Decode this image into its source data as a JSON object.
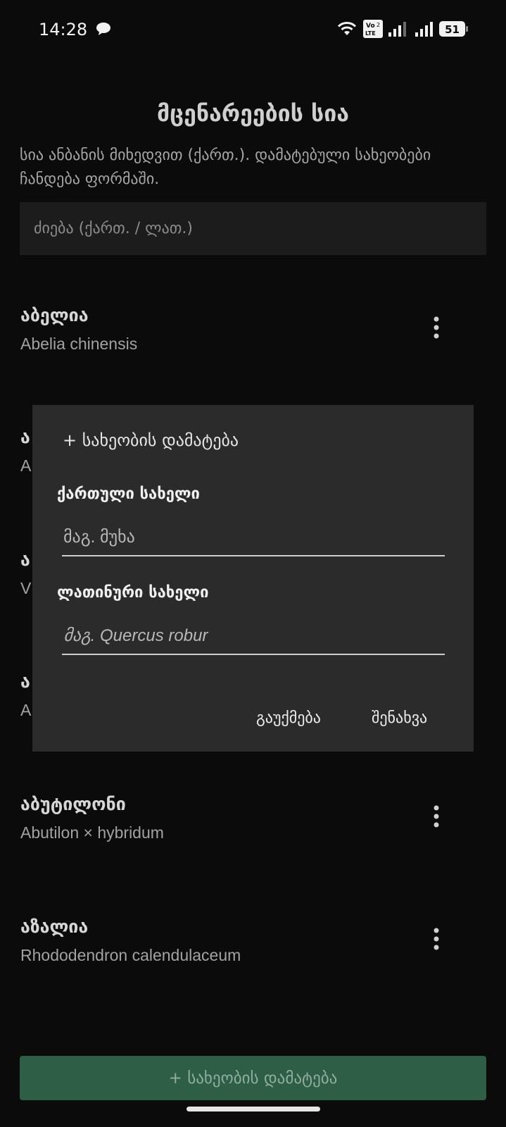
{
  "status_bar": {
    "time": "14:28",
    "volte_label": "Vo LTE",
    "battery": "51",
    "icons": [
      "chat-bubble-icon",
      "wifi-icon",
      "volte-icon",
      "signal-icon",
      "signal-icon",
      "battery-icon"
    ]
  },
  "header": {
    "title": "მცენარეების სია",
    "subtitle": "სია ანბანის მიხედვით (ქართ.). დამატებული სახეობები ჩანდება ფორმაში."
  },
  "search": {
    "placeholder": "ძიება (ქართ. / ლათ.)",
    "value": ""
  },
  "plants": [
    {
      "name": "აბელია",
      "latin": "Abelia chinensis"
    },
    {
      "name": "ა",
      "latin": "A"
    },
    {
      "name": "ა",
      "latin": "V"
    },
    {
      "name": "ა",
      "latin": "A"
    },
    {
      "name": "აბუტილონი",
      "latin": "Abutilon × hybridum"
    },
    {
      "name": "აზალია",
      "latin": "Rhododendron calendulaceum"
    }
  ],
  "dialog": {
    "title": "+ სახეობის დამატება",
    "georgian_label": "ქართული სახელი",
    "georgian_placeholder": "მაგ. მუხა",
    "latin_label": "ლათინური სახელი",
    "latin_placeholder": "მაგ. Quercus robur",
    "cancel_label": "გაუქმება",
    "save_label": "შენახვა"
  },
  "footer": {
    "add_button_label": "+ სახეობის დამატება"
  },
  "colors": {
    "background": "#0b0b0b",
    "dialog_bg": "#2b2b2b",
    "search_bg": "#1c1c1c",
    "accent_button": "#2e5e46"
  }
}
